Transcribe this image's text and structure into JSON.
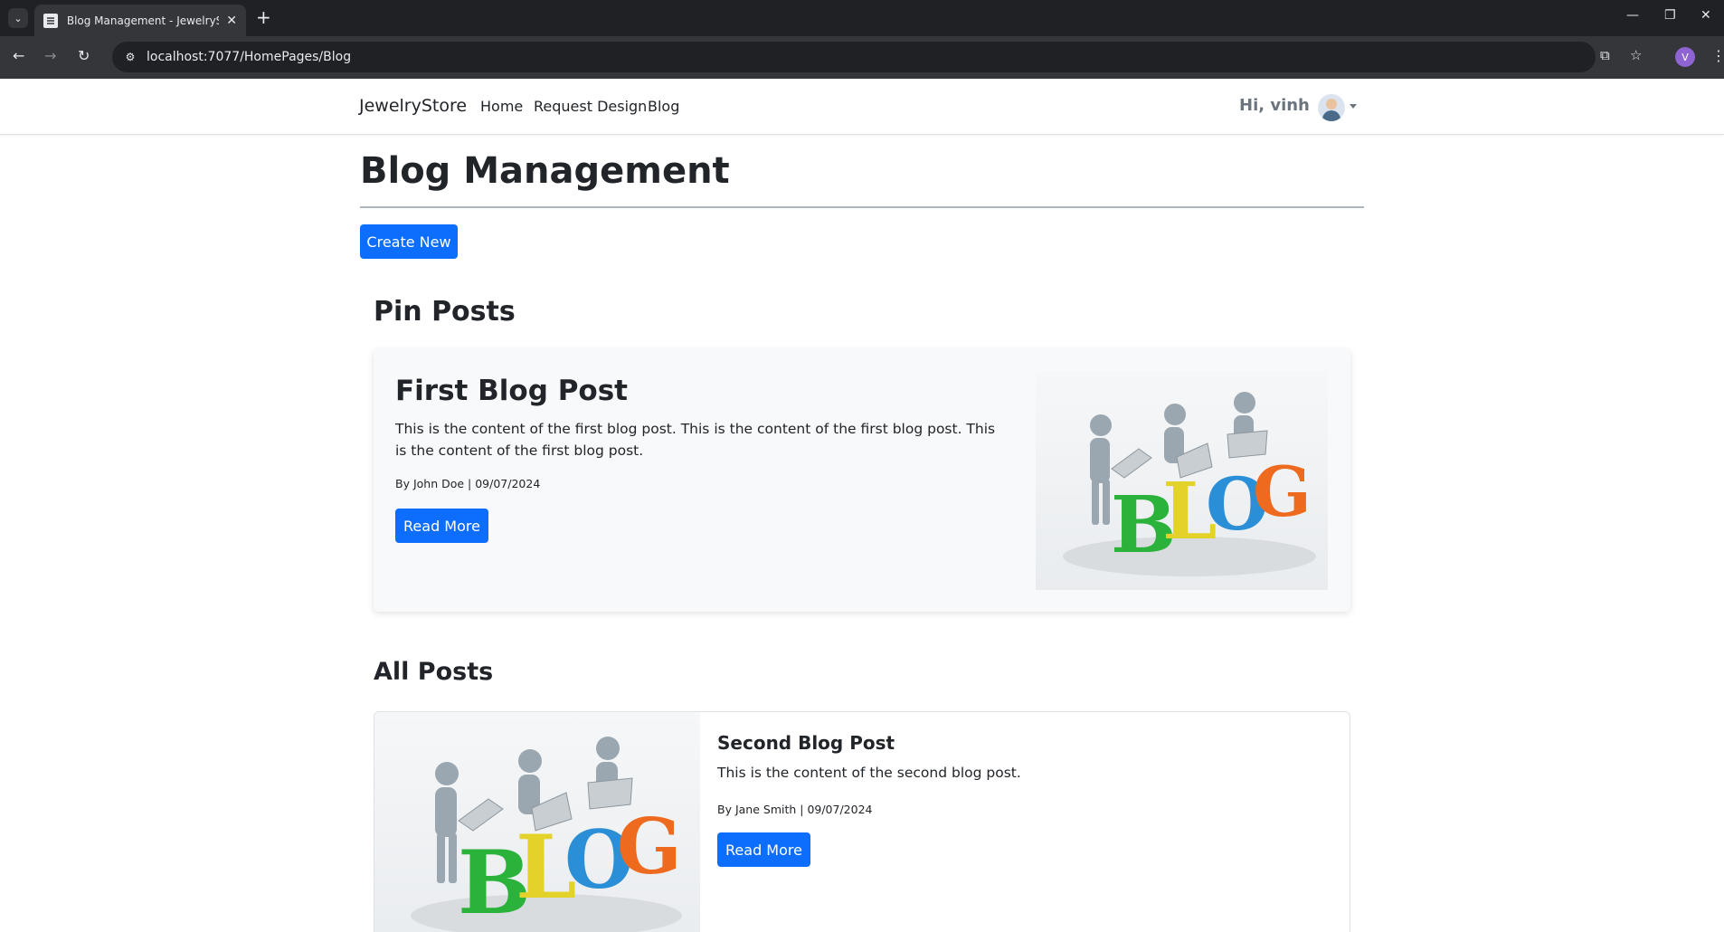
{
  "browser": {
    "tab_title": "Blog Management - JewelryStore",
    "url": "localhost:7077/HomePages/Blog",
    "profile_initial": "V"
  },
  "navbar": {
    "brand": "JewelryStore",
    "links": [
      "Home",
      "Request Design",
      "Blog"
    ],
    "greeting": "Hi, vinh"
  },
  "page": {
    "title": "Blog Management",
    "create_label": "Create New"
  },
  "pin_section": {
    "heading": "Pin Posts",
    "post": {
      "title": "First Blog Post",
      "content": "This is the content of the first blog post. This is the content of the first blog post. This is the content of the first blog post.",
      "meta": "By John Doe | 09/07/2024",
      "read_more": "Read More"
    }
  },
  "all_section": {
    "heading": "All Posts",
    "posts": [
      {
        "title": "Second Blog Post",
        "content": "This is the content of the second blog post.",
        "meta": "By Jane Smith | 09/07/2024",
        "read_more": "Read More"
      }
    ]
  },
  "blog_art_letters": [
    "B",
    "L",
    "O",
    "G"
  ],
  "colors": {
    "primary": "#0d6efd",
    "letter_b": "#2bb23a",
    "letter_l": "#e3d22a",
    "letter_o": "#2a8fd6",
    "letter_g": "#ee6a1e"
  }
}
